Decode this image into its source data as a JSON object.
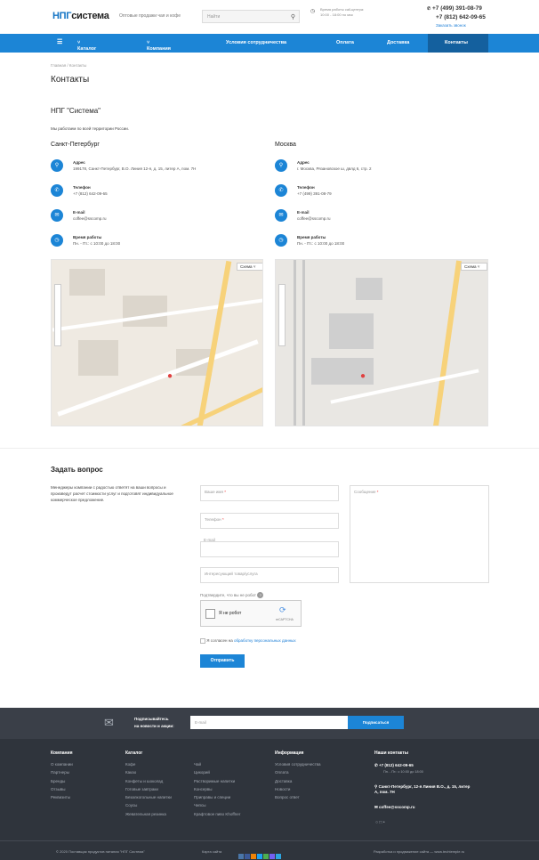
{
  "header": {
    "logo_a": "НПГ",
    "logo_b": "система",
    "tagline": "Оптовые продажи чая и кофе",
    "search_placeholder": "Найти",
    "hours": "Время работы call-центра: 10:00 - 18:00 по мск",
    "phone1": "+7 (499) 391-08-79",
    "phone2": "+7 (812) 642-09-65",
    "callback": "Заказать звонок"
  },
  "nav": {
    "catalog": "Каталог",
    "company": "Компания",
    "terms": "Условия сотрудничества",
    "payment": "Оплата",
    "delivery": "Доставка",
    "contacts": "Контакты"
  },
  "page": {
    "breadcrumb": "Главная  /  Контакты",
    "title": "Контакты",
    "company": "НПГ \"Система\"",
    "intro": "Мы работаем по всей территории России."
  },
  "spb": {
    "city": "Санкт-Петербург",
    "addr_label": "Адрес",
    "addr": "199178, Санкт-Петербург, В.О. Линия 12-я, д. 15, литер А, пом. 7Н",
    "phone_label": "Телефон",
    "phone": "+7 (812) 642-09-65",
    "email_label": "E-mail",
    "email": "coffee@sscomp.ru",
    "hours_label": "Время работы",
    "hours": "Пн. - Пт.: с 10:00 до 18:00",
    "map_btn": "Схема"
  },
  "msk": {
    "city": "Москва",
    "addr_label": "Адрес",
    "addr": "г. Москва, Рязановское ш, двлд 6, стр. 2",
    "phone_label": "Телефон",
    "phone": "+7 (499) 391-08-79",
    "email_label": "E-mail",
    "email": "coffee@sscomp.ru",
    "hours_label": "Время работы",
    "hours": "Пн. - Пт.: с 10:00 до 18:00",
    "map_btn": "Схема"
  },
  "form": {
    "title": "Задать вопрос",
    "text": "Менеджеры компании с радостью ответят на ваши вопросы и произведут расчет стоимости услуг и подготовят индивидуальное коммерческое предложение.",
    "name": "Ваше имя",
    "phone": "Телефон",
    "email": "E-mail",
    "goods": "Интересующий товар/услуга",
    "message": "Сообщение",
    "robot": "Подтвердите, что вы не робот",
    "captcha": "Я не робот",
    "recaptcha": "reCAPTCHA",
    "agree_pre": "Я согласен на ",
    "agree_link": "обработку персональных данных",
    "submit": "Отправить"
  },
  "subscribe": {
    "text1": "Подписывайтесь",
    "text2": "на новости и акции:",
    "placeholder": "E-mail",
    "button": "Подписаться"
  },
  "footer": {
    "col1_title": "Компания",
    "col1": [
      "О компании",
      "Партнеры",
      "Бренды",
      "Отзывы",
      "Реквизиты"
    ],
    "col2_title": "Каталог",
    "col2a": [
      "Кофе",
      "Какао",
      "Конфеты и шоколад",
      "Готовые завтраки",
      "Безалкогольные напитки",
      "Соусы",
      "Жевательная резинка"
    ],
    "col2b": [
      "Чай",
      "Цикорий",
      "Растворимые напитки",
      "Консервы",
      "Приправы и специи",
      "Чипсы",
      "Крафтовое пиво Khoffner"
    ],
    "col3_title": "Информация",
    "col3": [
      "Условия сотрудничества",
      "Оплата",
      "Доставка",
      "Новости",
      "Вопрос ответ"
    ],
    "col4_title": "Наши контакты",
    "phone": "+7 (812) 642-09-65",
    "phone_hours": "Пн. - Пт.: с 10:00 до 18:00",
    "address": "Санкт-Петербург, 12-я Линия В.О., д. 15, литер А, пом. 7Н",
    "email": "coffee@sscomp.ru",
    "copyright": "© 2020 Поставщик продуктов питания \"НПГ Система\"",
    "sitemap": "Карта сайта",
    "dev": "Разработка и продвижение сайта — www.techtemple.ru"
  },
  "colors": {
    "accent": "#1c85d6",
    "nav_active": "#14609e",
    "footer": "#2f343c"
  }
}
